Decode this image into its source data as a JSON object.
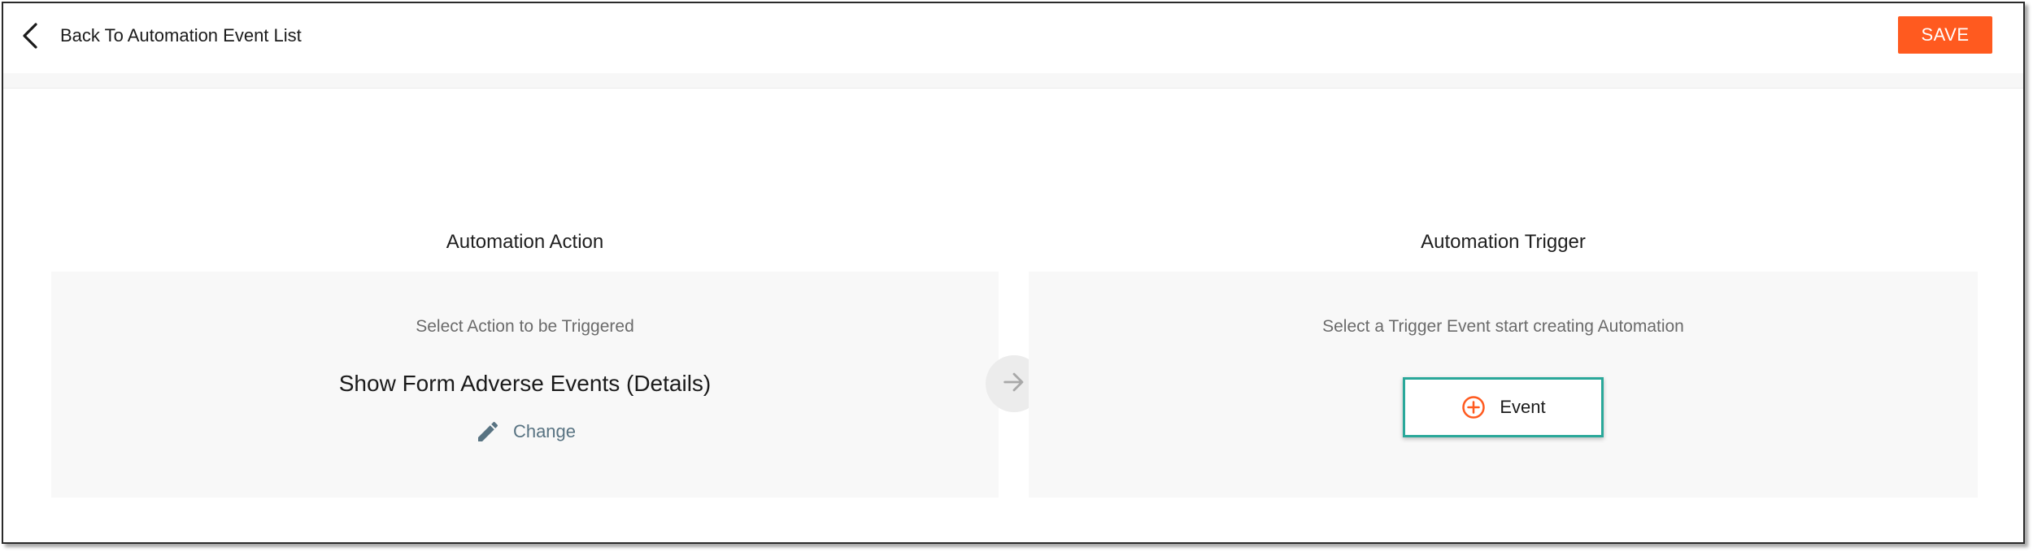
{
  "header": {
    "back_label": "Back To Automation Event List",
    "save_label": "SAVE"
  },
  "action_panel": {
    "heading": "Automation Action",
    "subtitle": "Select Action to be Triggered",
    "action_name": "Show Form Adverse Events (Details)",
    "change_label": "Change"
  },
  "trigger_panel": {
    "heading": "Automation Trigger",
    "subtitle": "Select a Trigger Event start creating Automation",
    "event_button_label": "Event"
  },
  "icons": {
    "back": "chevron-left-icon",
    "pencil": "pencil-icon",
    "arrow": "arrow-right-icon",
    "plus": "plus-circle-icon"
  },
  "colors": {
    "accent": "#ff5a1f",
    "highlight_border": "#2aa89a",
    "link": "#587382"
  }
}
